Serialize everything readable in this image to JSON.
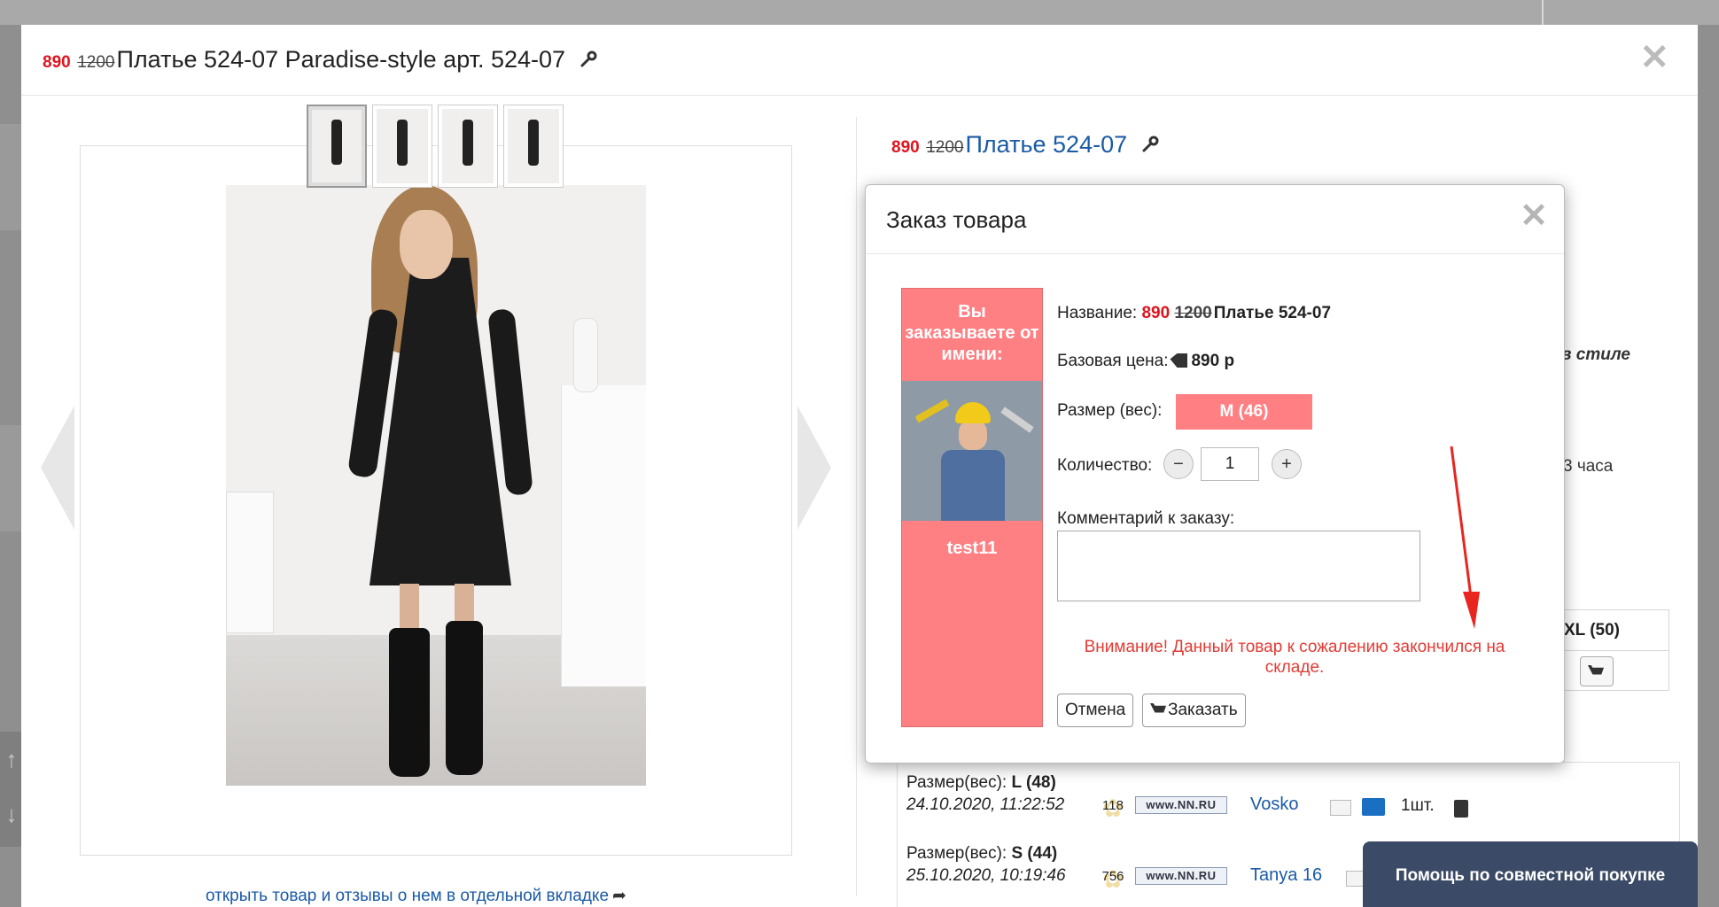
{
  "main_modal": {
    "price_new": "890",
    "price_old": "1200",
    "title": "Платье 524-07 Paradise-style арт. 524-07",
    "close_label": "✕"
  },
  "gallery": {
    "open_link": "открыть товар и отзывы о нем в отдельной вкладке",
    "thumbnail_count": 4
  },
  "product": {
    "price_new": "890",
    "price_old": "1200",
    "title": "Платье 524-07",
    "bg_text_style": "в стиле",
    "bg_text_hours": "3 часа",
    "size_header": "XL (50)"
  },
  "orders": [
    {
      "size_label": "Размер(вес):",
      "size_value": "L (48)",
      "date": "24.10.2020, 11:22:52",
      "rating": "118",
      "site": "www.NN.RU",
      "user": "Vosko",
      "qty": "1шт."
    },
    {
      "size_label": "Размер(вес):",
      "size_value": "S (44)",
      "date": "25.10.2020, 10:19:46",
      "rating": "756",
      "site": "www.NN.RU",
      "user": "Tanya 16"
    }
  ],
  "help_button": "Помощь по совместной покупке",
  "dialog": {
    "title": "Заказ товара",
    "close_label": "✕",
    "ordering_as": "Вы заказываете от имени:",
    "username": "test11",
    "name_label": "Название:",
    "name_price_new": "890",
    "name_price_old": "1200",
    "name_value": "Платье 524-07",
    "base_price_label": "Базовая цена:",
    "base_price_value": "890 р",
    "size_label": "Размер (вес):",
    "size_value": "M (46)",
    "qty_label": "Количество:",
    "qty_minus": "−",
    "qty_value": "1",
    "qty_plus": "+",
    "comment_label": "Комментарий к заказу:",
    "comment_value": "",
    "warning": "Внимание! Данный товар к сожалению закончился на складе.",
    "cancel_label": "Отмена",
    "order_label": "Заказать"
  },
  "colors": {
    "price_red": "#e0141e",
    "link_blue": "#1a5aa6",
    "user_panel": "#ff8083",
    "warning_red": "#e23b35",
    "help_bg": "#3b4a66"
  }
}
